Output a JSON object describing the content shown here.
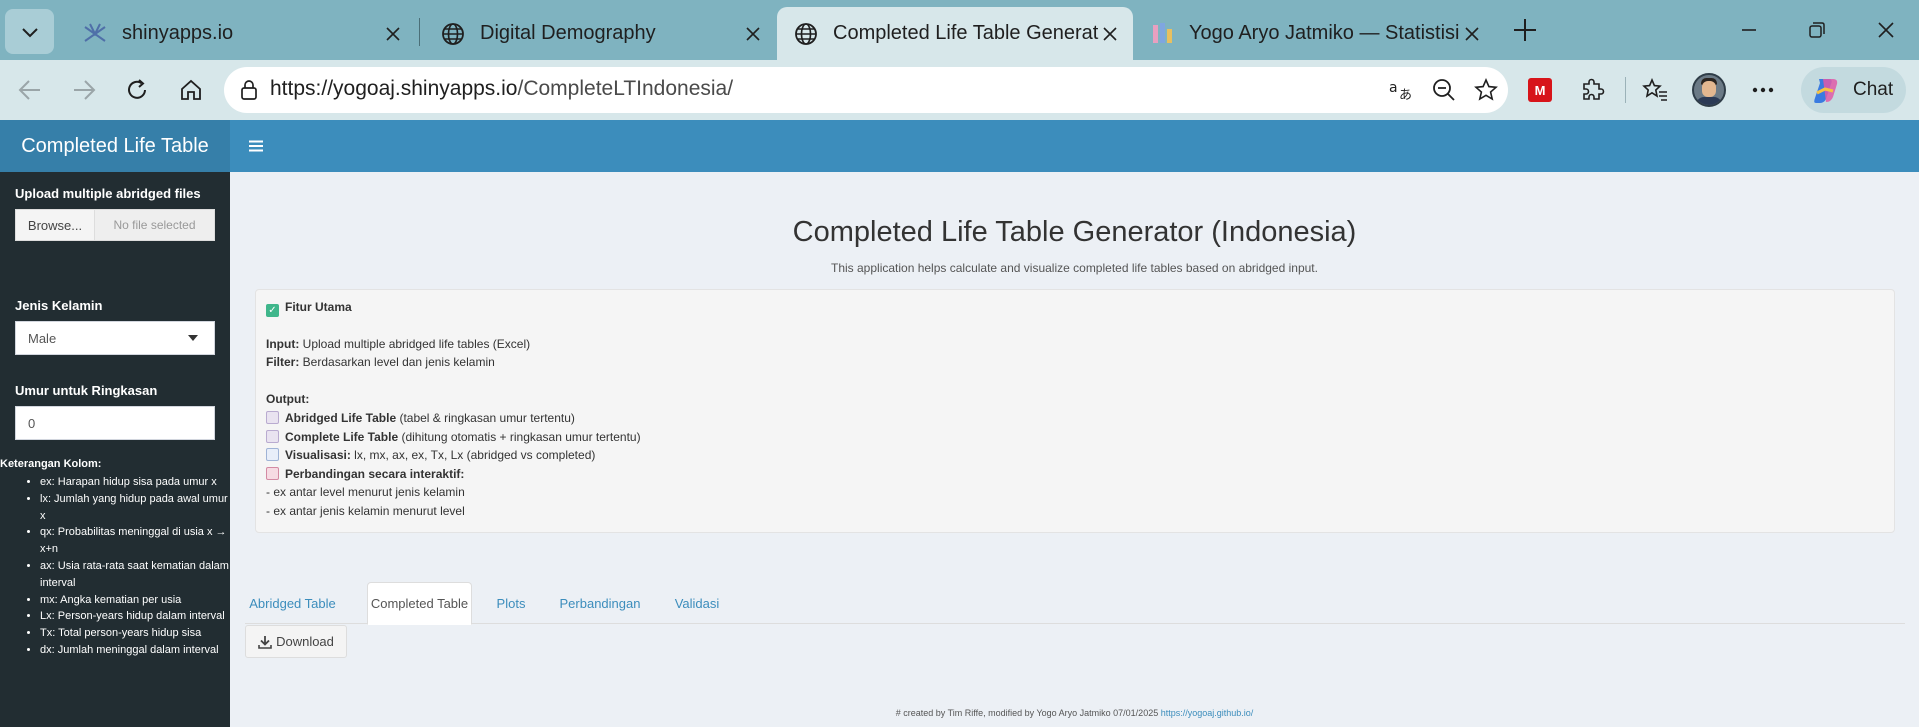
{
  "browser": {
    "tabs": [
      {
        "title": "shinyapps.io",
        "icon": "shinyapps-icon"
      },
      {
        "title": "Digital Demography",
        "icon": "globe-icon"
      },
      {
        "title": "Completed Life Table Generator (In",
        "icon": "globe-icon",
        "active": true
      },
      {
        "title": "Yogo Aryo Jatmiko — Statistisi, De",
        "icon": "bar-chart-favicon"
      }
    ],
    "url_host": "https://yogoaj.shinyapps.io",
    "url_path": "/CompleteLTIndonesia/",
    "chat_label": "Chat",
    "extension_label": "M"
  },
  "app": {
    "logo": "Completed Life Table",
    "sidebar": {
      "upload_label": "Upload multiple abridged files",
      "browse_label": "Browse...",
      "no_file": "No file selected",
      "sex_label": "Jenis Kelamin",
      "sex_value": "Male",
      "age_label": "Umur untuk Ringkasan",
      "age_value": "0",
      "legend_title": "Keterangan Kolom:",
      "legend_items": [
        {
          "key": "ex:",
          "text": " Harapan hidup sisa pada umur x"
        },
        {
          "key": "lx:",
          "text": " Jumlah yang hidup pada awal umur x"
        },
        {
          "key": "qx:",
          "text": " Probabilitas meninggal di usia x → x+n"
        },
        {
          "key": "ax:",
          "text": " Usia rata-rata saat kematian dalam interval"
        },
        {
          "key": "mx:",
          "text": " Angka kematian per usia"
        },
        {
          "key": "Lx:",
          "text": " Person-years hidup dalam interval"
        },
        {
          "key": "Tx:",
          "text": " Total person-years hidup sisa"
        },
        {
          "key": "dx:",
          "text": " Jumlah meninggal dalam interval"
        }
      ]
    },
    "main": {
      "title": "Completed Life Table Generator (Indonesia)",
      "subtitle": "This application helps calculate and visualize completed life tables based on abridged input.",
      "features": {
        "heading": "Fitur Utama",
        "input_key": "Input:",
        "input_text": " Upload multiple abridged life tables (Excel)",
        "filter_key": "Filter:",
        "filter_text": " Berdasarkan level dan jenis kelamin",
        "output_key": "Output:",
        "out1_key": "Abridged Life Table",
        "out1_text": " (tabel & ringkasan umur tertentu)",
        "out2_key": "Complete Life Table",
        "out2_text": " (dihitung otomatis + ringkasan umur tertentu)",
        "out3_key": "Visualisasi:",
        "out3_text": " lx, mx, ax, ex, Tx, Lx (abridged vs completed)",
        "out4_key": "Perbandingan secara interaktif:",
        "sub1": "- ex antar level menurut jenis kelamin",
        "sub2": "- ex antar jenis kelamin menurut level"
      },
      "tabs": [
        "Abridged Table",
        "Completed Table",
        "Plots",
        "Perbandingan",
        "Validasi"
      ],
      "active_tab": "Completed Table",
      "download_label": "Download",
      "footer_text": "# created by Tim Riffe, modified by Yogo Aryo Jatmiko 07/01/2025 ",
      "footer_link": "https://yogoaj.github.io/"
    }
  }
}
